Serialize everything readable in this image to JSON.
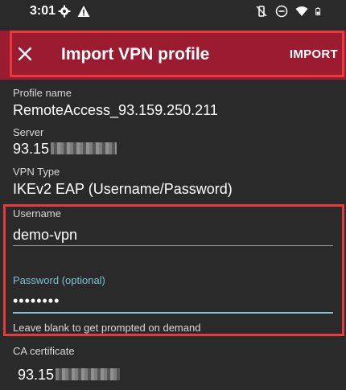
{
  "status_bar": {
    "time": "3:01",
    "left_icons": [
      "gear-icon",
      "warning-icon"
    ],
    "right_icons": [
      "vibrate-off-icon",
      "do-not-disturb-icon",
      "wifi-icon",
      "battery-icon"
    ]
  },
  "app_bar": {
    "close_icon": "close-icon",
    "title": "Import VPN profile",
    "import_label": "IMPORT",
    "color": "#9b1c31"
  },
  "profile": {
    "name_label": "Profile name",
    "name_value": "RemoteAccess_93.159.250.211",
    "server_label": "Server",
    "server_value_visible": "93.15",
    "vpn_type_label": "VPN Type",
    "vpn_type_value": "IKEv2 EAP (Username/Password)"
  },
  "credentials": {
    "username_label": "Username",
    "username_value": "demo-vpn",
    "password_label": "Password (optional)",
    "password_value": "••••••••",
    "password_hint": "Leave blank to get prompted on demand"
  },
  "ca_certificate": {
    "label": "CA certificate",
    "selected_visible": "93.15"
  },
  "colors": {
    "background": "#2a2a2a",
    "highlight_border": "#e83a3a",
    "accent": "#7ec2d2"
  }
}
